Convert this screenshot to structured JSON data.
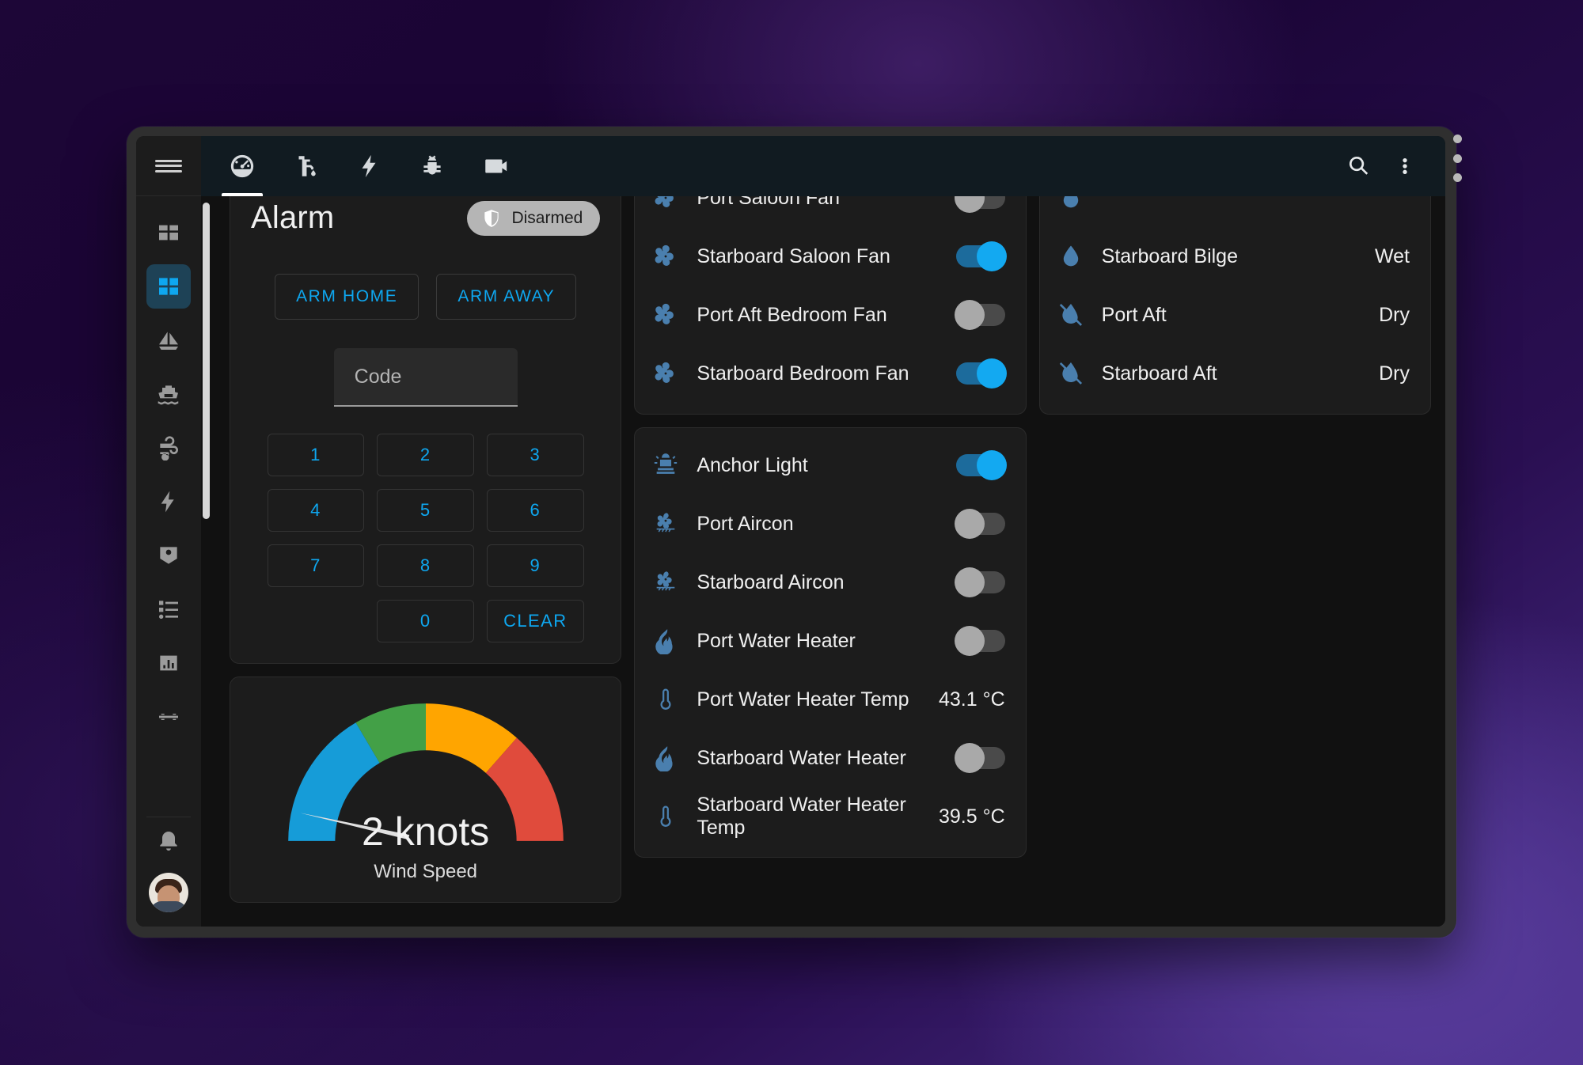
{
  "window": {
    "sidebar": {
      "menu_icon": "hamburger-menu-icon",
      "items": [
        {
          "name": "sidebar-item-overview",
          "icon": "view-dashboard-icon",
          "active": false
        },
        {
          "name": "sidebar-item-boat-dashboard",
          "icon": "view-dashboard-variant-icon",
          "active": true
        },
        {
          "name": "sidebar-item-sailing",
          "icon": "sail-boat-icon",
          "active": false
        },
        {
          "name": "sidebar-item-ferry",
          "icon": "ferry-icon",
          "active": false
        },
        {
          "name": "sidebar-item-weather",
          "icon": "weather-windy-icon",
          "active": false
        },
        {
          "name": "sidebar-item-energy",
          "icon": "lightning-bolt-icon",
          "active": false
        },
        {
          "name": "sidebar-item-map",
          "icon": "account-badge-icon",
          "active": false
        },
        {
          "name": "sidebar-item-logbook",
          "icon": "format-list-icon",
          "active": false
        },
        {
          "name": "sidebar-item-history",
          "icon": "chart-box-icon",
          "active": false
        },
        {
          "name": "sidebar-item-media",
          "icon": "remote-icon",
          "active": false
        }
      ],
      "bottom": [
        {
          "name": "sidebar-item-notifications",
          "icon": "bell-icon"
        },
        {
          "name": "sidebar-item-user-profile",
          "icon": "user-avatar"
        }
      ]
    },
    "toolbar": {
      "tabs": [
        {
          "name": "tab-overview",
          "icon": "gauge-icon",
          "active": true
        },
        {
          "name": "tab-water",
          "icon": "water-pump-icon",
          "active": false
        },
        {
          "name": "tab-power",
          "icon": "lightning-bolt-icon",
          "active": false
        },
        {
          "name": "tab-debug",
          "icon": "bug-icon",
          "active": false
        },
        {
          "name": "tab-cameras",
          "icon": "video-camera-icon",
          "active": false
        }
      ],
      "search_icon": "search-icon",
      "overflow_icon": "dots-vertical-icon"
    },
    "columns": {
      "left": {
        "alarm_card": {
          "title": "Alarm",
          "status_badge": {
            "label": "Disarmed",
            "icon": "shield-off-icon"
          },
          "arm_home_label": "ARM HOME",
          "arm_away_label": "ARM AWAY",
          "code_placeholder": "Code",
          "code_value": "",
          "keys": [
            "1",
            "2",
            "3",
            "4",
            "5",
            "6",
            "7",
            "8",
            "9",
            "",
            "0",
            "CLEAR"
          ]
        },
        "gauge_card": {
          "value_text": "2 knots",
          "label": "Wind Speed"
        }
      },
      "middle": {
        "fans_card": {
          "rows": [
            {
              "icon": "fan-icon",
              "name": "Port Saloon Fan",
              "control": "toggle",
              "state": "off",
              "clipped": true
            },
            {
              "icon": "fan-icon",
              "name": "Starboard Saloon Fan",
              "control": "toggle",
              "state": "on"
            },
            {
              "icon": "fan-icon",
              "name": "Port Aft Bedroom Fan",
              "control": "toggle",
              "state": "off"
            },
            {
              "icon": "fan-icon",
              "name": "Starboard Bedroom Fan",
              "control": "toggle",
              "state": "on"
            }
          ]
        },
        "systems_card": {
          "rows": [
            {
              "icon": "alarm-light-icon",
              "name": "Anchor Light",
              "control": "toggle",
              "state": "on"
            },
            {
              "icon": "air-conditioner-icon",
              "name": "Port Aircon",
              "control": "toggle",
              "state": "off"
            },
            {
              "icon": "air-conditioner-icon",
              "name": "Starboard Aircon",
              "control": "toggle",
              "state": "off"
            },
            {
              "icon": "fire-icon",
              "name": "Port Water Heater",
              "control": "toggle",
              "state": "off"
            },
            {
              "icon": "thermometer-icon",
              "name": "Port Water Heater Temp",
              "control": "value",
              "value": "43.1 °C"
            },
            {
              "icon": "fire-icon",
              "name": "Starboard Water Heater",
              "control": "toggle",
              "state": "off"
            },
            {
              "icon": "thermometer-icon",
              "name": "Starboard Water Heater Temp",
              "control": "value",
              "value": "39.5 °C"
            }
          ]
        }
      },
      "right": {
        "bilge_card": {
          "rows": [
            {
              "icon": "water-icon",
              "name": "",
              "control": "value",
              "value": "",
              "clipped": true
            },
            {
              "icon": "water-icon",
              "name": "Starboard Bilge",
              "control": "value",
              "value": "Wet"
            },
            {
              "icon": "water-off-icon",
              "name": "Port Aft",
              "control": "value",
              "value": "Dry"
            },
            {
              "icon": "water-off-icon",
              "name": "Starboard Aft",
              "control": "value",
              "value": "Dry"
            }
          ]
        }
      }
    }
  },
  "chart_data": {
    "type": "gauge",
    "title": "Wind Speed",
    "value": 2,
    "unit": "knots",
    "value_text": "2 knots",
    "min": 0,
    "max": 30,
    "needle_fraction": 0.07,
    "segments": [
      {
        "name": "light",
        "from": 0.0,
        "to": 0.33,
        "color": "#169cd8"
      },
      {
        "name": "moderate",
        "from": 0.33,
        "to": 0.5,
        "color": "#43a047"
      },
      {
        "name": "fresh",
        "from": 0.5,
        "to": 0.73,
        "color": "#ffa500"
      },
      {
        "name": "strong",
        "from": 0.73,
        "to": 1.0,
        "color": "#e04b3c"
      }
    ],
    "needle_color": "#e0e0e0",
    "grid": false,
    "legend": "none"
  }
}
